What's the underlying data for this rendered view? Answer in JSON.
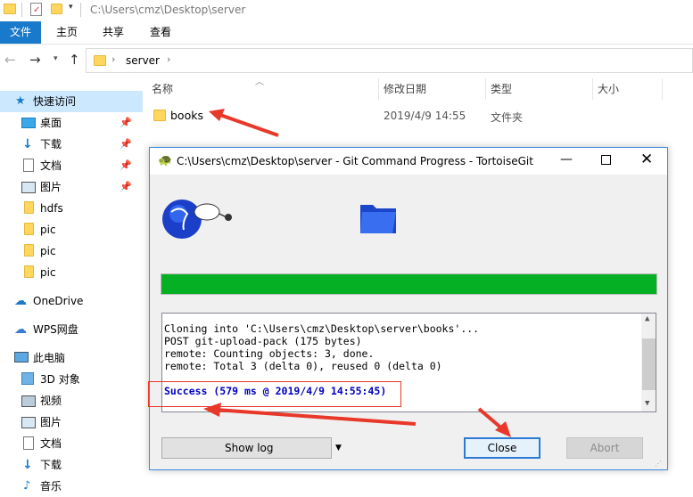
{
  "window": {
    "path_title": "C:\\Users\\cmz\\Desktop\\server"
  },
  "ribbon": {
    "tabs": [
      "文件",
      "主页",
      "共享",
      "查看"
    ]
  },
  "address": {
    "crumb": "server"
  },
  "nav": {
    "quick_access": "快速访问",
    "items": [
      {
        "label": "桌面",
        "pinned": true
      },
      {
        "label": "下载",
        "pinned": true
      },
      {
        "label": "文档",
        "pinned": true
      },
      {
        "label": "图片",
        "pinned": true
      },
      {
        "label": "hdfs",
        "pinned": false
      },
      {
        "label": "pic",
        "pinned": false
      },
      {
        "label": "pic",
        "pinned": false
      },
      {
        "label": "pic",
        "pinned": false
      }
    ],
    "onedrive": "OneDrive",
    "wps": "WPS网盘",
    "thispc": "此电脑",
    "pc_items": [
      "3D 对象",
      "视频",
      "图片",
      "文档",
      "下载",
      "音乐"
    ]
  },
  "columns": {
    "name": "名称",
    "modified": "修改日期",
    "type": "类型",
    "size": "大小"
  },
  "files": [
    {
      "name": "books",
      "modified": "2019/4/9 14:55",
      "type": "文件夹",
      "size": ""
    }
  ],
  "dialog": {
    "title": "C:\\Users\\cmz\\Desktop\\server - Git Command Progress - TortoiseGit",
    "progress": 1.0,
    "progress_color": "#06b025",
    "log": [
      "Cloning into 'C:\\Users\\cmz\\Desktop\\server\\books'...",
      "POST git-upload-pack (175 bytes)",
      "remote: Counting objects: 3, done.",
      "remote: Total 3 (delta 0), reused 0 (delta 0)"
    ],
    "success": "Success (579 ms @ 2019/4/9 14:55:45)",
    "show_log": "Show log",
    "close": "Close",
    "abort": "Abort"
  },
  "colors": {
    "accent": "#1979ca",
    "annotation": "#e8382a",
    "success_text": "#0000c0"
  }
}
